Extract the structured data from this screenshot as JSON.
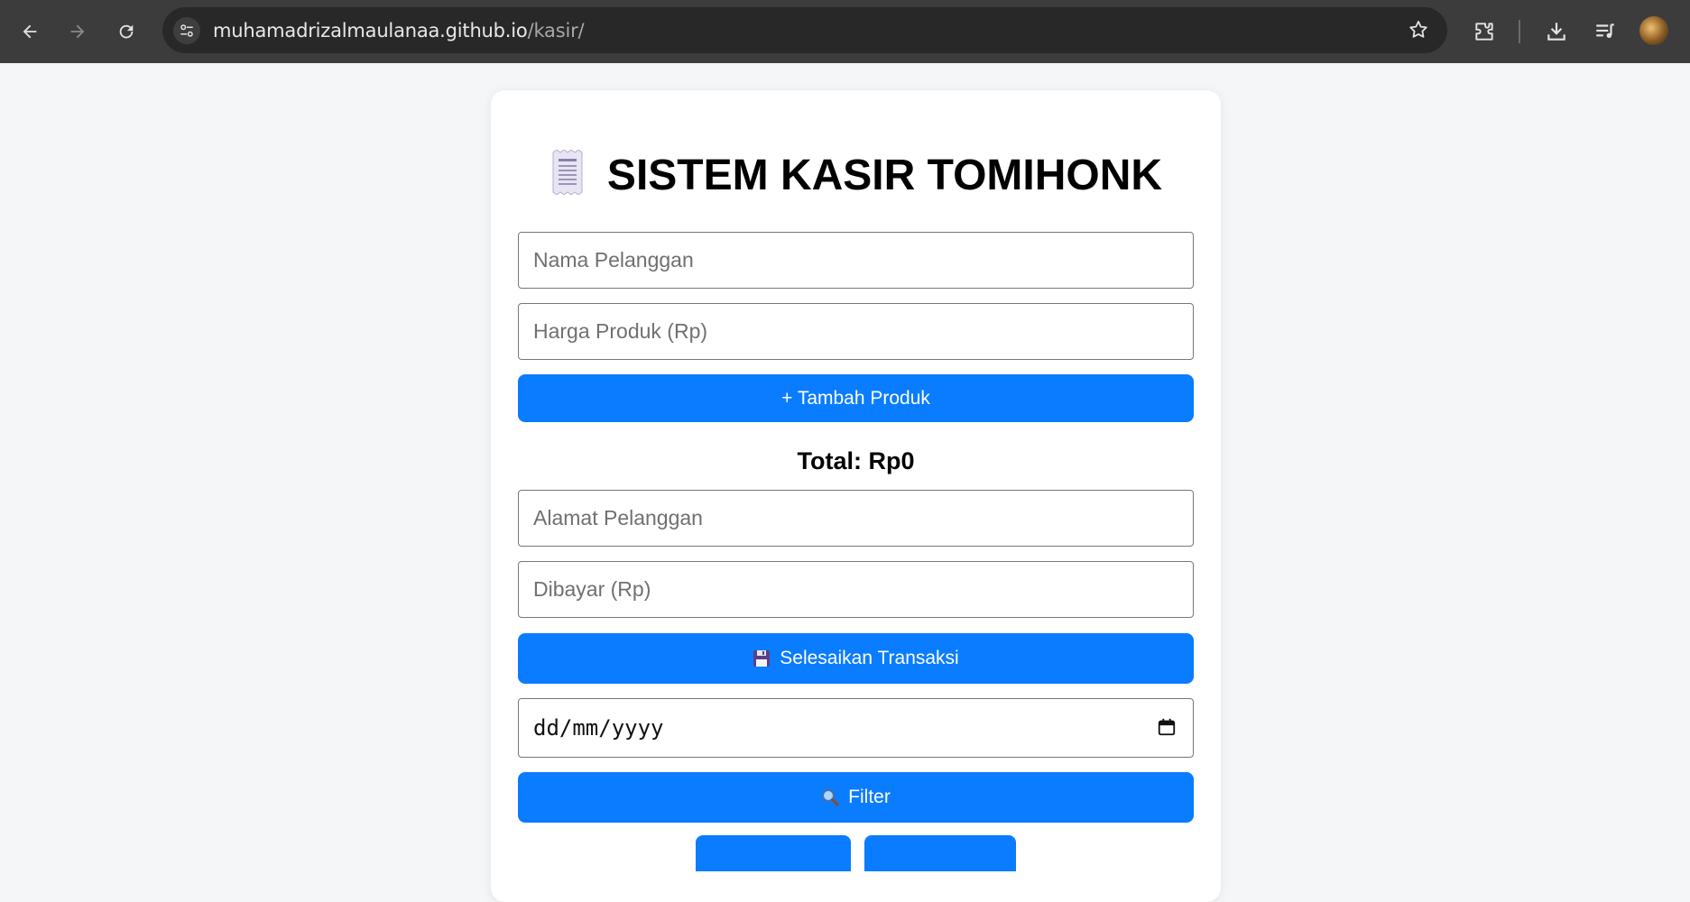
{
  "browser": {
    "url_host": "muhamadrizalmaulanaa.github.io",
    "url_path": "/kasir/",
    "icons": [
      "back-arrow-icon",
      "forward-arrow-icon",
      "reload-icon",
      "site-settings-icon",
      "bookmark-star-icon",
      "extensions-icon",
      "download-icon",
      "media-controls-icon",
      "profile-avatar"
    ]
  },
  "page": {
    "title": "SISTEM KASIR TOMIHONK",
    "title_icon": "receipt-icon",
    "customer_name_placeholder": "Nama Pelanggan",
    "product_price_placeholder": "Harga Produk (Rp)",
    "add_product_label": "+ Tambah Produk",
    "total_label": "Total: Rp0",
    "customer_address_placeholder": "Alamat Pelanggan",
    "paid_placeholder": "Dibayar (Rp)",
    "finish_label": "Selesaikan Transaksi",
    "finish_icon": "floppy-disk-icon",
    "date_format": "dd/mm/yyyy",
    "filter_label": "Filter",
    "filter_icon": "magnifier-icon"
  },
  "colors": {
    "accent": "#0a7cff",
    "chrome": "#3c3c3c",
    "page_bg": "#f4f6f8"
  }
}
